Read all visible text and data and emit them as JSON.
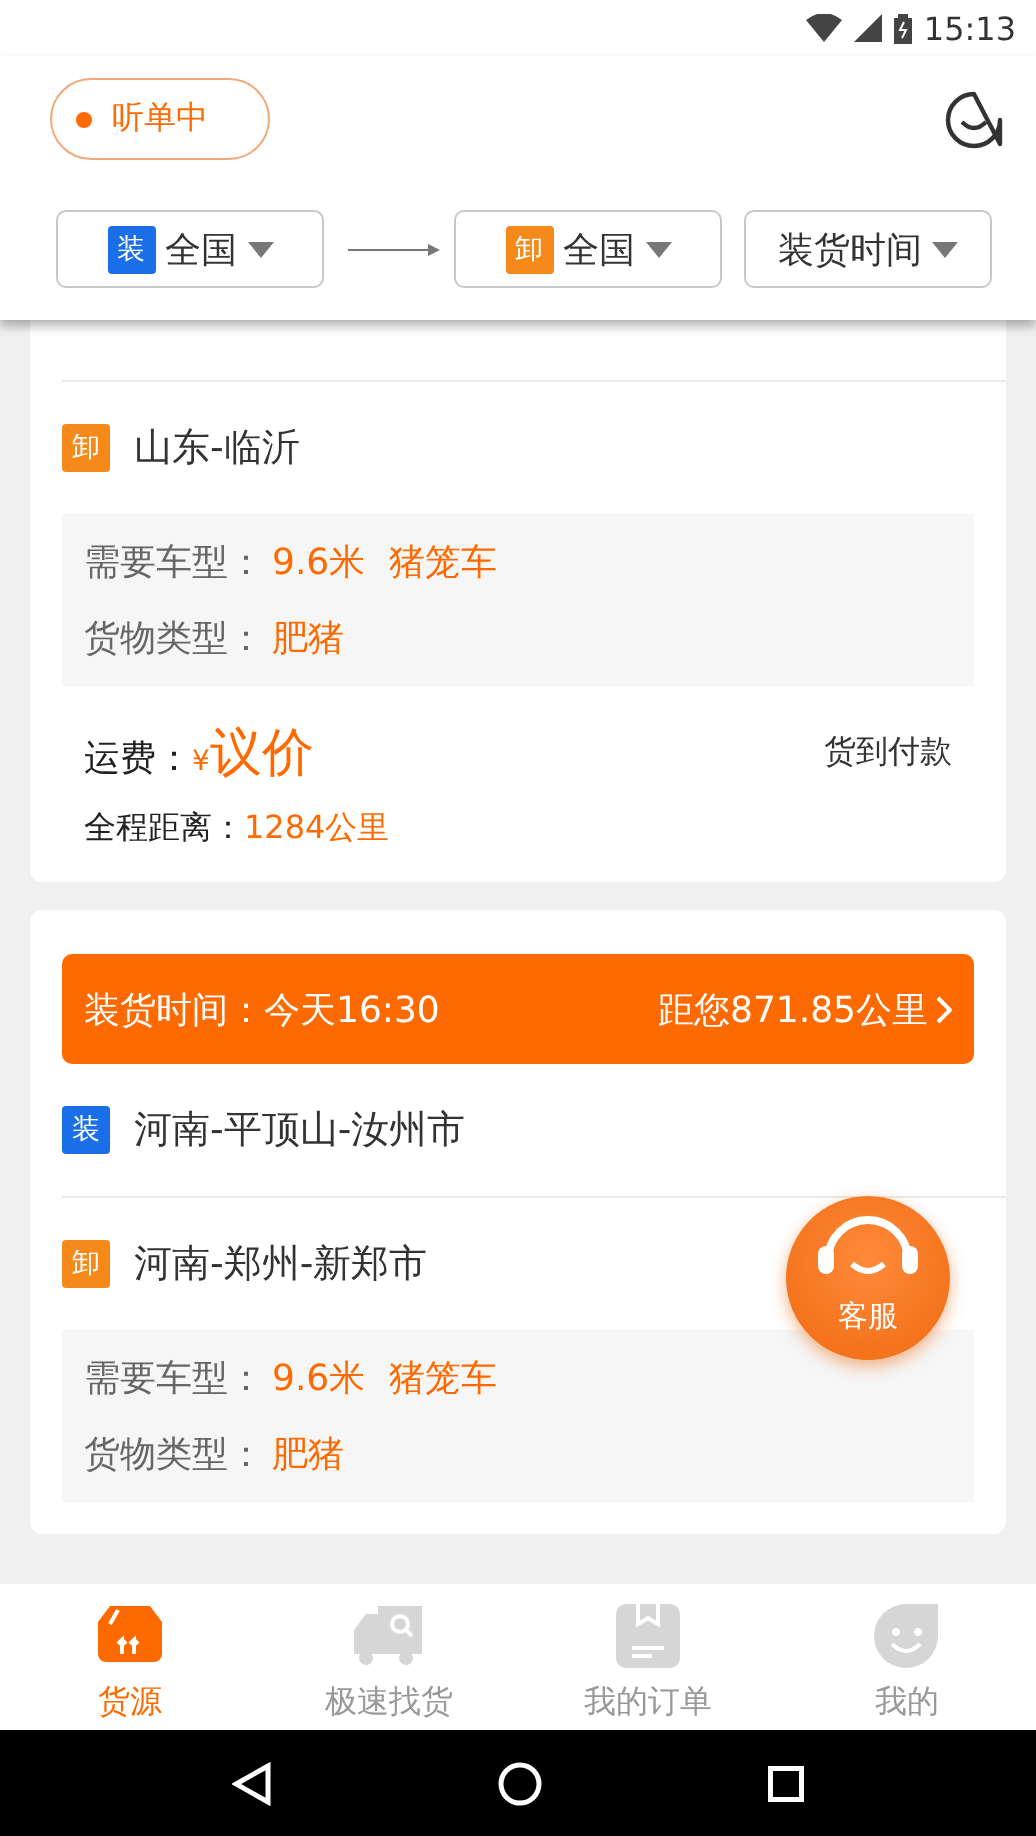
{
  "status_bar": {
    "time": "15:13"
  },
  "header": {
    "listening": {
      "label": "听单中",
      "on": true
    }
  },
  "filters": [
    {
      "kind": "origin",
      "tag": "装",
      "label": "全国"
    },
    {
      "kind": "destination",
      "tag": "卸",
      "label": "全国"
    },
    {
      "kind": "sort",
      "label": "装货时间"
    }
  ],
  "orders": [
    {
      "stops": [
        {
          "kind": "unload",
          "tag": "卸",
          "place": "山东-临沂"
        }
      ],
      "vehicle_label": "需要车型：",
      "vehicle_length": "9.6米",
      "vehicle_type": "猪笼车",
      "cargo_label": "货物类型：",
      "cargo": "肥猪",
      "fare_label": "运费：",
      "currency": "¥",
      "fare": "议价",
      "payment": "货到付款",
      "distance_label": "全程距离：",
      "distance": "1284公里"
    },
    {
      "load_time_label": "装货时间：",
      "load_time": "今天16:30",
      "distance_from_you": "距您871.85公里",
      "stops": [
        {
          "kind": "load",
          "tag": "装",
          "place": "河南-平顶山-汝州市"
        },
        {
          "kind": "unload",
          "tag": "卸",
          "place": "河南-郑州-新郑市"
        }
      ],
      "vehicle_label": "需要车型：",
      "vehicle_length": "9.6米",
      "vehicle_type": "猪笼车",
      "cargo_label": "货物类型：",
      "cargo": "肥猪"
    }
  ],
  "service_button": {
    "label": "客服"
  },
  "tabs": [
    {
      "label": "货源",
      "selected": true
    },
    {
      "label": "极速找货",
      "selected": false
    },
    {
      "label": "我的订单",
      "selected": false
    },
    {
      "label": "我的",
      "selected": false
    }
  ]
}
